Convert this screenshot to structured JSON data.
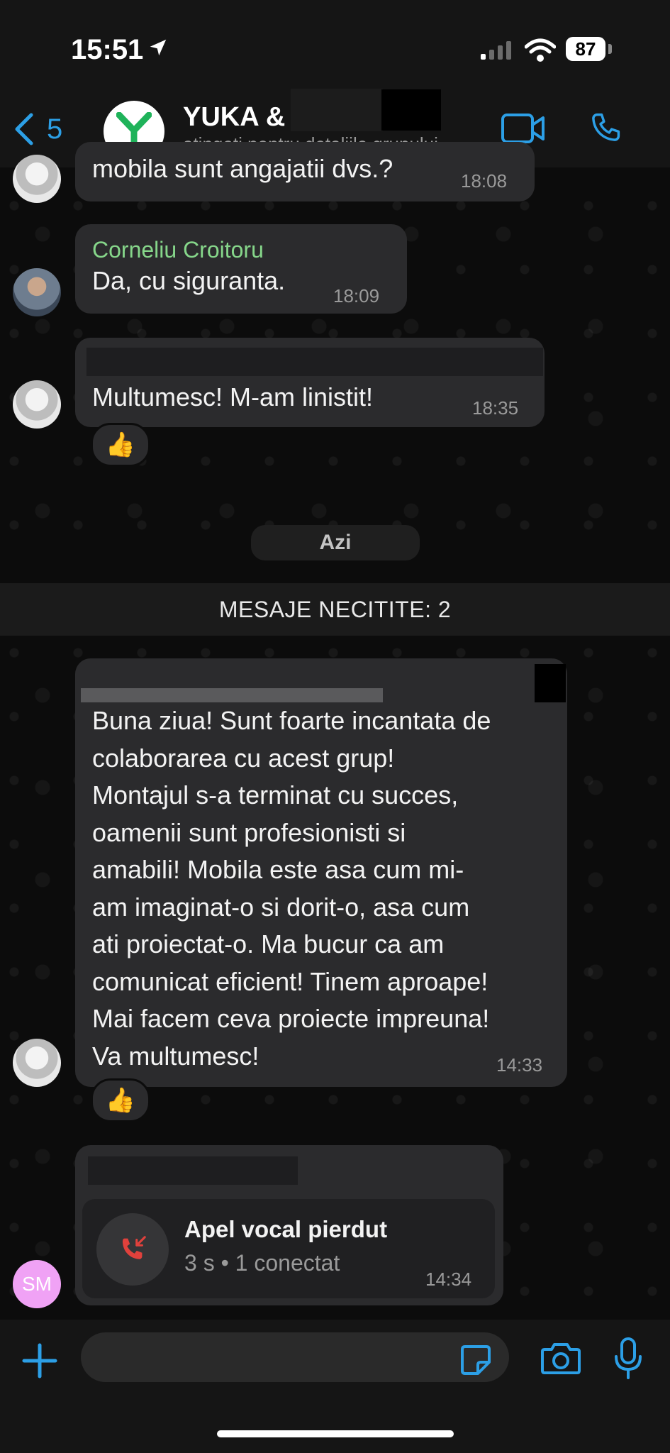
{
  "status_bar": {
    "time": "15:51",
    "battery": "87"
  },
  "header": {
    "back_count": "5",
    "group_name": "YUKA & I",
    "group_subtitle": "atingeți pentru detaliile grupului",
    "avatar_letter": "Y"
  },
  "messages": [
    {
      "text": "mobila sunt angajatii dvs.?",
      "time": "18:08"
    },
    {
      "sender": "Corneliu Croitoru",
      "text": "Da, cu siguranta.",
      "time": "18:09"
    },
    {
      "text": "Multumesc! M-am linistit!",
      "time": "18:35",
      "reaction": "👍"
    }
  ],
  "day_separator": "Azi",
  "unread_banner": "MESAJE NECITITE: 2",
  "long_message": {
    "lines": [
      "Buna ziua! Sunt foarte incantata de",
      "colaborarea cu acest grup!",
      "Montajul s-a terminat cu succes,",
      "oamenii sunt profesionisti si",
      "amabili! Mobila este asa cum mi-",
      "am imaginat-o si dorit-o,  asa cum",
      "ati proiectat-o.  Ma bucur ca am",
      "comunicat eficient! Tinem aproape!",
      "Mai facem ceva proiecte impreuna!",
      "Va multumesc!"
    ],
    "time": "14:33",
    "reaction": "👍"
  },
  "missed_call": {
    "title": "Apel vocal pierdut",
    "details": "3 s • 1 conectat",
    "time": "14:34",
    "avatar_initials": "SM"
  },
  "input_bar": {
    "placeholder": ""
  },
  "icons": {
    "back": "chevron-left-icon",
    "video": "video-camera-icon",
    "phone": "phone-icon",
    "plus": "plus-icon",
    "sticker": "sticker-icon",
    "camera": "camera-icon",
    "mic": "microphone-icon",
    "missed_call": "missed-call-icon"
  },
  "colors": {
    "accent": "#2c9fe6",
    "sender_name": "#86d68a",
    "missed_call": "#e0413c",
    "bubble": "#2b2b2d",
    "sm_avatar": "#f0a2f5"
  }
}
